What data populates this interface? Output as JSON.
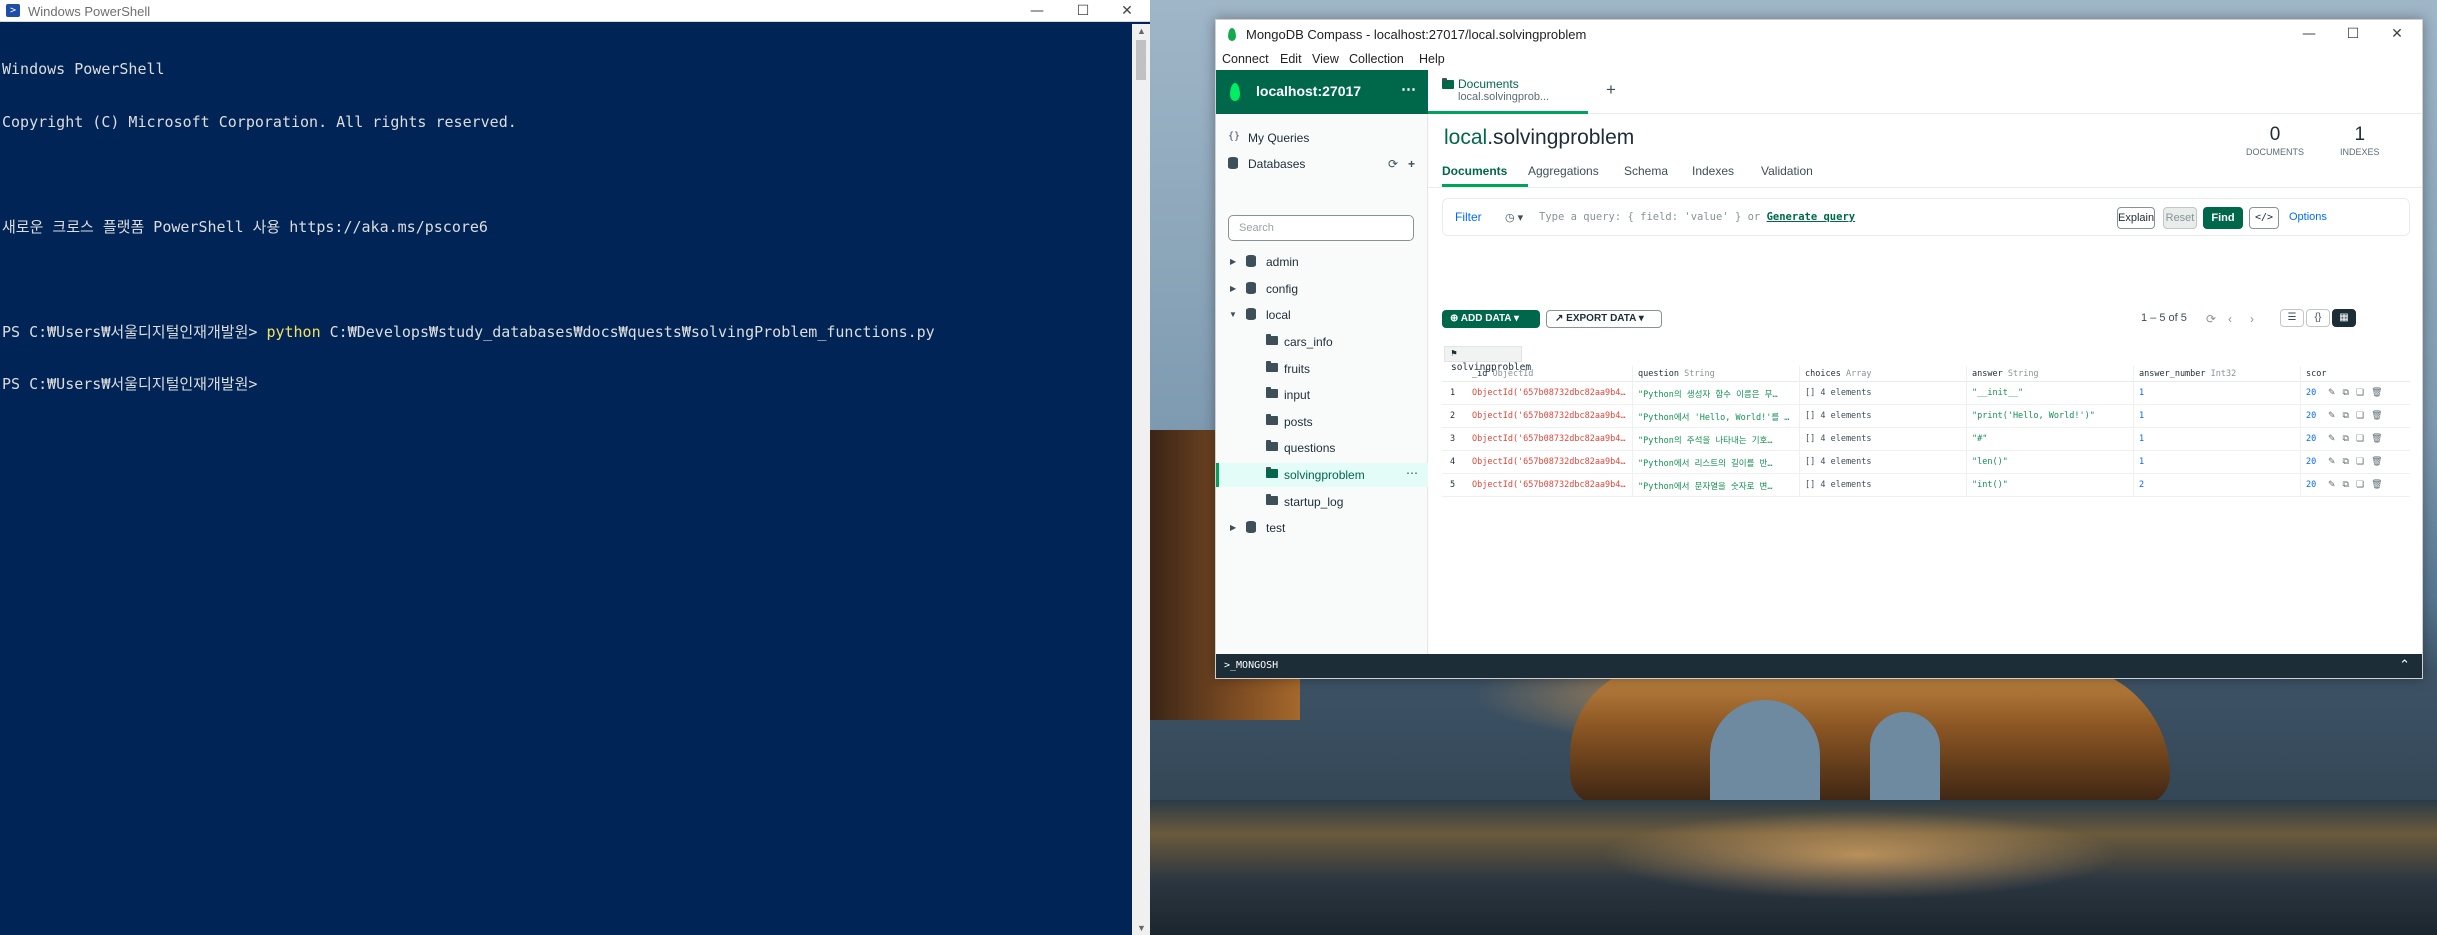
{
  "powershell": {
    "title": "Windows PowerShell",
    "lines": [
      "Windows PowerShell",
      "Copyright (C) Microsoft Corporation. All rights reserved.",
      "",
      "새로운 크로스 플랫폼 PowerShell 사용 https://aka.ms/pscore6",
      ""
    ],
    "prompt1": "PS C:₩Users₩서울디지털인재개발원> ",
    "command": "python",
    "command_arg": " C:₩Develops₩study_databases₩docs₩quests₩solvingProblem_functions.py",
    "prompt2": "PS C:₩Users₩서울디지털인재개발원>"
  },
  "compass": {
    "title": "MongoDB Compass - localhost:27017/local.solvingproblem",
    "menu": [
      "Connect",
      "Edit",
      "View",
      "Collection",
      "Help"
    ],
    "connection": "localhost:27017",
    "sidebar": {
      "my_queries": "My Queries",
      "databases": "Databases",
      "search_placeholder": "Search",
      "dbs": [
        {
          "name": "admin"
        },
        {
          "name": "config"
        },
        {
          "name": "local"
        }
      ],
      "collections": [
        "cars_info",
        "fruits",
        "input",
        "posts",
        "questions",
        "solvingproblem",
        "startup_log"
      ],
      "last_db": "test"
    },
    "tab": {
      "title": "Documents",
      "subtitle": "local.solvingprob..."
    },
    "namespace": {
      "db": "local",
      "collection": ".solvingproblem"
    },
    "stats": {
      "documents": "0",
      "documents_label": "DOCUMENTS",
      "indexes": "1",
      "indexes_label": "INDEXES"
    },
    "subtabs": [
      "Documents",
      "Aggregations",
      "Schema",
      "Indexes",
      "Validation"
    ],
    "query": {
      "filter_label": "Filter",
      "placeholder": "Type a query: { field: 'value' } or",
      "generate": "Generate query",
      "explain": "Explain",
      "reset": "Reset",
      "find": "Find",
      "options": "Options"
    },
    "toolbar": {
      "add_data": "ADD DATA",
      "export_data": "EXPORT DATA",
      "pager": "1 – 5 of 5"
    },
    "collection_badge": "solvingproblem",
    "grid": {
      "headers": [
        {
          "name": "_id",
          "type": "ObjectId"
        },
        {
          "name": "question",
          "type": "String"
        },
        {
          "name": "choices",
          "type": "Array"
        },
        {
          "name": "answer",
          "type": "String"
        },
        {
          "name": "answer_number",
          "type": "Int32"
        },
        {
          "name": "scor",
          "type": ""
        }
      ],
      "rows": [
        {
          "n": "1",
          "id": "ObjectId('657b08732dbc82aa9b4…",
          "question": "\"Python의 생성자 함수 이름은 무…",
          "choices": "[] 4 elements",
          "answer": "\"__init__\"",
          "answer_number": "1",
          "score": "20"
        },
        {
          "n": "2",
          "id": "ObjectId('657b08732dbc82aa9b4…",
          "question": "\"Python에서 'Hello, World!'를 …",
          "choices": "[] 4 elements",
          "answer": "\"print('Hello, World!')\"",
          "answer_number": "1",
          "score": "20"
        },
        {
          "n": "3",
          "id": "ObjectId('657b08732dbc82aa9b4…",
          "question": "\"Python의 주석을 나타내는 기호…",
          "choices": "[] 4 elements",
          "answer": "\"#\"",
          "answer_number": "1",
          "score": "20"
        },
        {
          "n": "4",
          "id": "ObjectId('657b08732dbc82aa9b4…",
          "question": "\"Python에서 리스트의 길이를 반…",
          "choices": "[] 4 elements",
          "answer": "\"len()\"",
          "answer_number": "1",
          "score": "20"
        },
        {
          "n": "5",
          "id": "ObjectId('657b08732dbc82aa9b4…",
          "question": "\"Python에서 문자열을 숫자로 변…",
          "choices": "[] 4 elements",
          "answer": "\"int()\"",
          "answer_number": "2",
          "score": "20"
        }
      ]
    },
    "mongosh": ">_MONGOSH"
  }
}
